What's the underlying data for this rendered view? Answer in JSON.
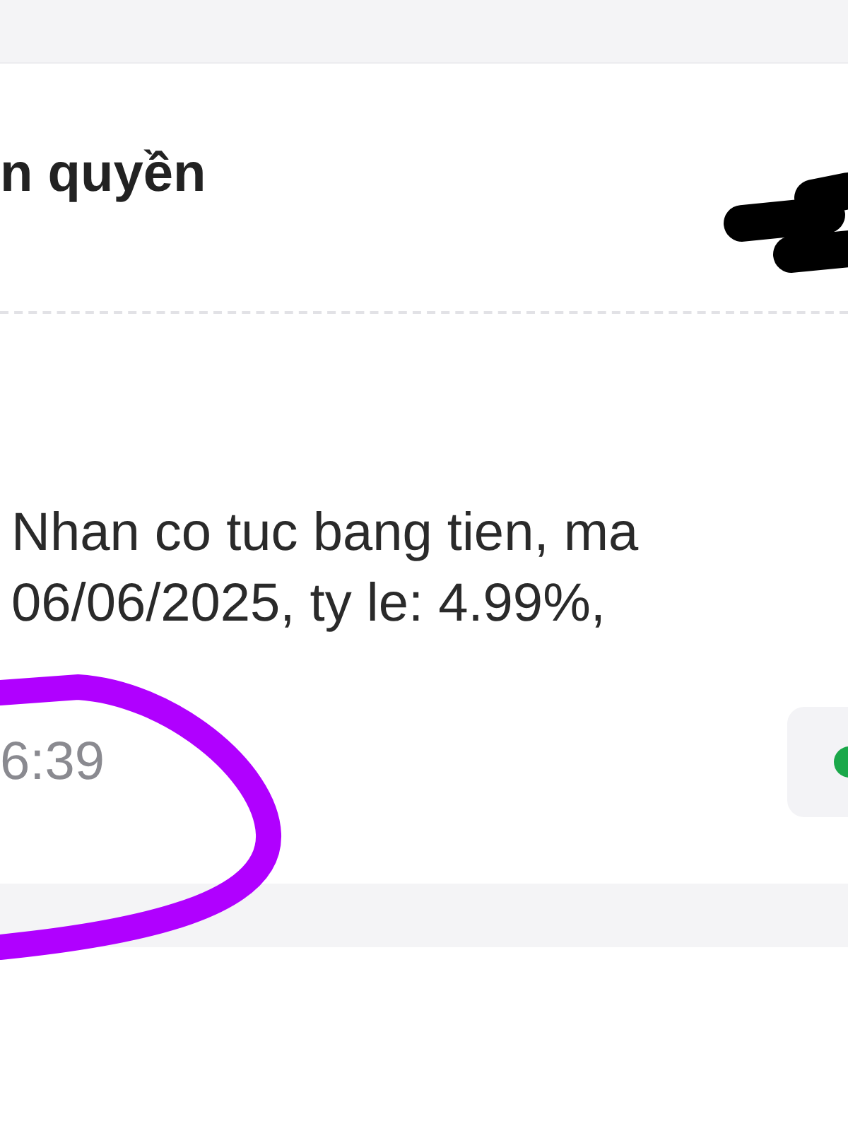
{
  "header": {
    "title": "n quyền"
  },
  "message": {
    "lines": [
      "Nhan co tuc bang tien, ma",
      "06/06/2025, ty le: 4.99%,"
    ],
    "time": "6:39",
    "status": {
      "color": "#1aa84a"
    }
  }
}
